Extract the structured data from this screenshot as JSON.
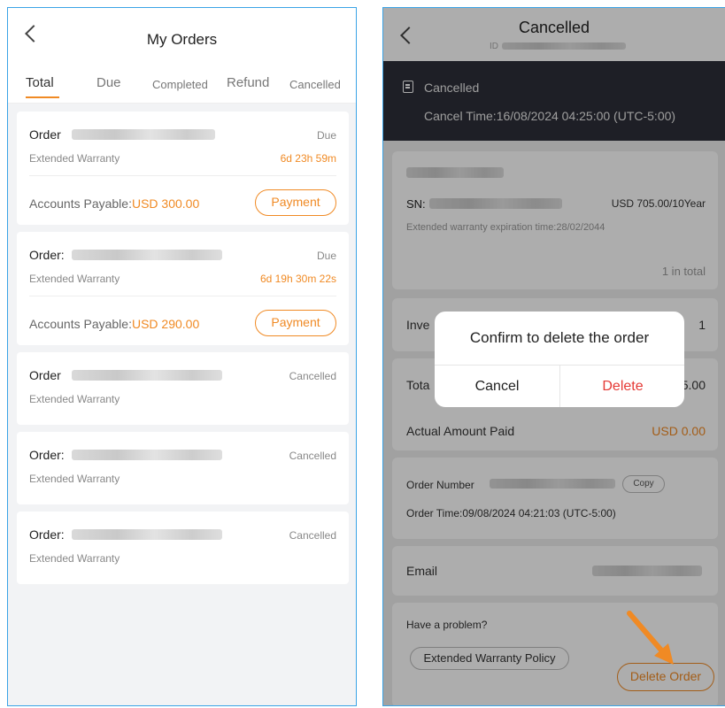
{
  "left": {
    "title": "My Orders",
    "tabs": [
      "Total",
      "Due",
      "Completed",
      "Refund",
      "Cancelled"
    ],
    "orders": [
      {
        "label": "Order",
        "status": "Due",
        "type": "Extended Warranty",
        "time_left": "6d 23h 59m",
        "payable_label": "Accounts Payable:",
        "payable_amount": "USD 300.00",
        "action": "Payment"
      },
      {
        "label": "Order:",
        "status": "Due",
        "type": "Extended Warranty",
        "time_left": "6d 19h 30m 22s",
        "payable_label": "Accounts Payable:",
        "payable_amount": "USD 290.00",
        "action": "Payment"
      },
      {
        "label": "Order",
        "status": "Cancelled",
        "type": "Extended Warranty"
      },
      {
        "label": "Order:",
        "status": "Cancelled",
        "type": "Extended Warranty"
      },
      {
        "label": "Order:",
        "status": "Cancelled",
        "type": "Extended Warranty"
      }
    ]
  },
  "right": {
    "title": "Cancelled",
    "id_label": "ID",
    "banner": {
      "status": "Cancelled",
      "cancel_time": "Cancel Time:16/08/2024 04:25:00 (UTC-5:00)"
    },
    "product": {
      "sn_label": "SN:",
      "price": "USD 705.00/10Year",
      "expiration": "Extended warranty expiration time:28/02/2044",
      "total": "1 in total"
    },
    "invoice": {
      "label": "Inve",
      "value": "1"
    },
    "totals": {
      "label": "Tota",
      "value": "5.00",
      "paid_label": "Actual Amount Paid",
      "paid_value": "USD 0.00"
    },
    "order_info": {
      "number_label": "Order Number",
      "copy": "Copy",
      "time": "Order Time:09/08/2024 04:21:03 (UTC-5:00)"
    },
    "email_label": "Email",
    "help": {
      "question": "Have a problem?",
      "policy": "Extended Warranty Policy"
    },
    "delete_order": "Delete Order",
    "dialog": {
      "title": "Confirm to delete the order",
      "cancel": "Cancel",
      "delete": "Delete"
    }
  },
  "colors": {
    "accent": "#f08a24",
    "danger": "#e53935",
    "frame": "#3aa3e6",
    "banner": "#2d2f38"
  }
}
